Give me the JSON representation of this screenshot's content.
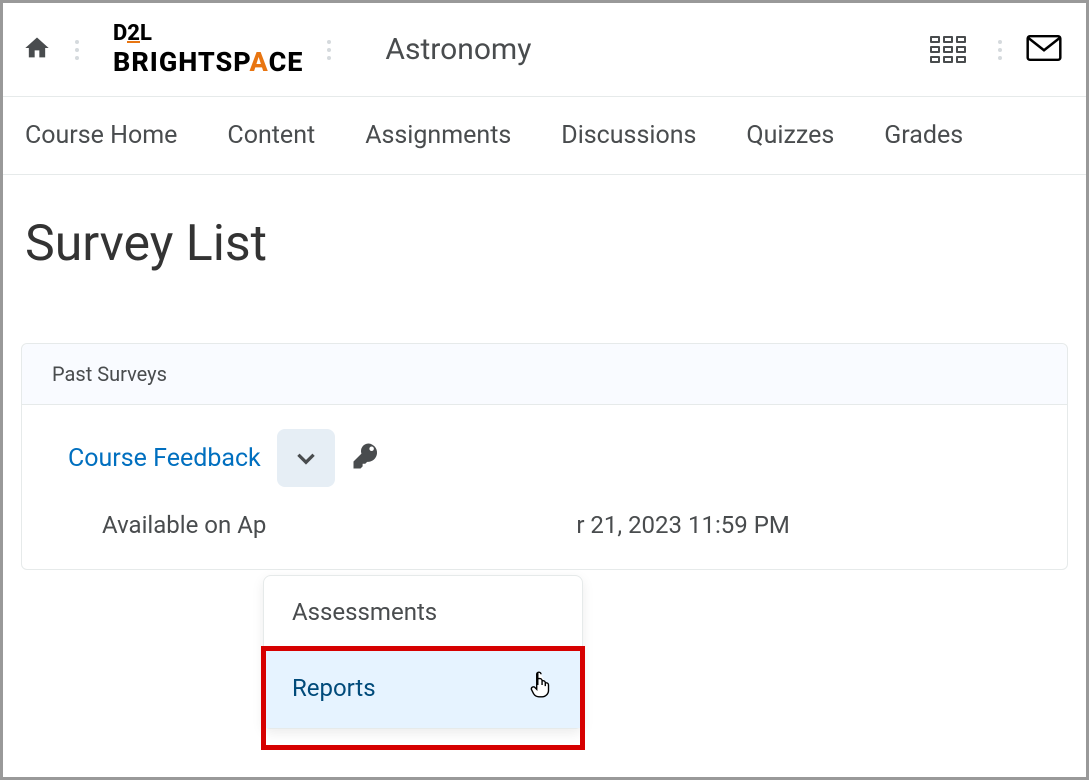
{
  "header": {
    "course_title": "Astronomy"
  },
  "navbar": {
    "items": [
      {
        "label": "Course Home"
      },
      {
        "label": "Content"
      },
      {
        "label": "Assignments"
      },
      {
        "label": "Discussions"
      },
      {
        "label": "Quizzes"
      },
      {
        "label": "Grades"
      }
    ]
  },
  "page": {
    "title": "Survey List"
  },
  "panel": {
    "header": "Past Surveys"
  },
  "survey": {
    "name": "Course Feedback",
    "availability_prefix": "Available on Ap",
    "availability_suffix": "r 21, 2023 11:59 PM"
  },
  "dropdown": {
    "items": [
      {
        "label": "Assessments"
      },
      {
        "label": "Reports"
      }
    ]
  }
}
